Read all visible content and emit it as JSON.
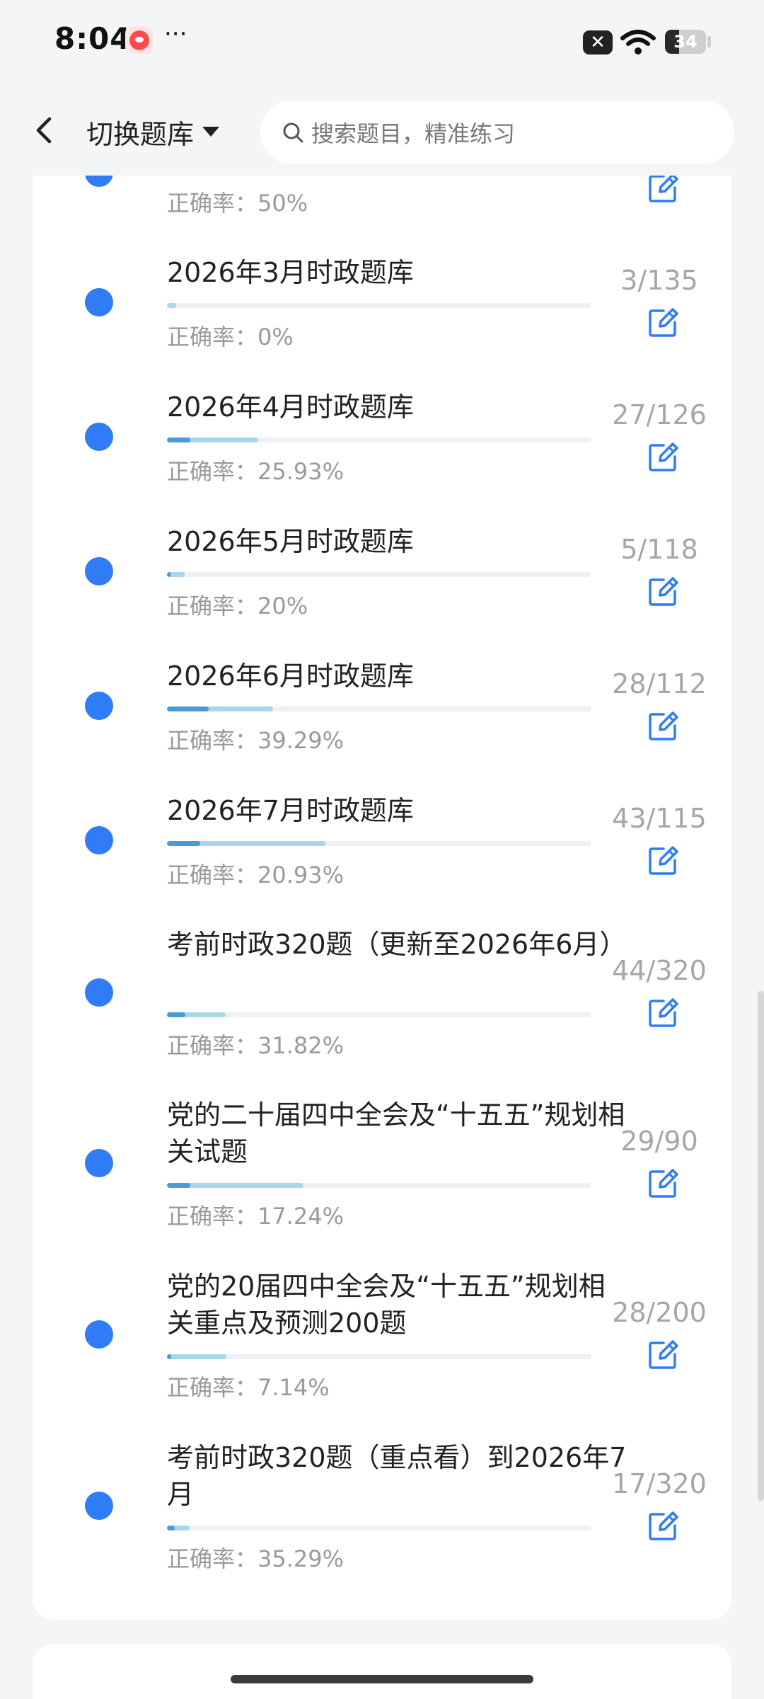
{
  "status_bar": {
    "time": "8:04",
    "more": "···",
    "battery": "34",
    "battery_level": 0.34
  },
  "header": {
    "switch_label": "切换题库",
    "search_placeholder": "搜索题目，精准练习"
  },
  "accuracy_prefix": "正确率：",
  "colors": {
    "dot": "#2f7cf6",
    "bar_track": "#eef0f3",
    "bar_done": "#a9d7ea",
    "bar_correct": "#4a9ad6",
    "edit_icon": "#2f7cf6"
  },
  "items": [
    {
      "title": "",
      "accuracy": "50%",
      "done": null,
      "total": null,
      "count": ""
    },
    {
      "title": "2026年3月时政题库",
      "accuracy": "0%",
      "done": 3,
      "total": 135,
      "count": "3/135"
    },
    {
      "title": "2026年4月时政题库",
      "accuracy": "25.93%",
      "done": 27,
      "total": 126,
      "count": "27/126"
    },
    {
      "title": "2026年5月时政题库",
      "accuracy": "20%",
      "done": 5,
      "total": 118,
      "count": "5/118"
    },
    {
      "title": "2026年6月时政题库",
      "accuracy": "39.29%",
      "done": 28,
      "total": 112,
      "count": "28/112"
    },
    {
      "title": "2026年7月时政题库",
      "accuracy": "20.93%",
      "done": 43,
      "total": 115,
      "count": "43/115"
    },
    {
      "title": "考前时政320题（更新至2026年6月）",
      "accuracy": "31.82%",
      "done": 44,
      "total": 320,
      "count": "44/320"
    },
    {
      "title": "党的二十届四中全会及“十五五”规划相关试题",
      "accuracy": "17.24%",
      "done": 29,
      "total": 90,
      "count": "29/90"
    },
    {
      "title": "党的20届四中全会及“十五五”规划相关重点及预测200题",
      "accuracy": "7.14%",
      "done": 28,
      "total": 200,
      "count": "28/200"
    },
    {
      "title": "考前时政320题（重点看）到2026年7月",
      "accuracy": "35.29%",
      "done": 17,
      "total": 320,
      "count": "17/320"
    }
  ]
}
